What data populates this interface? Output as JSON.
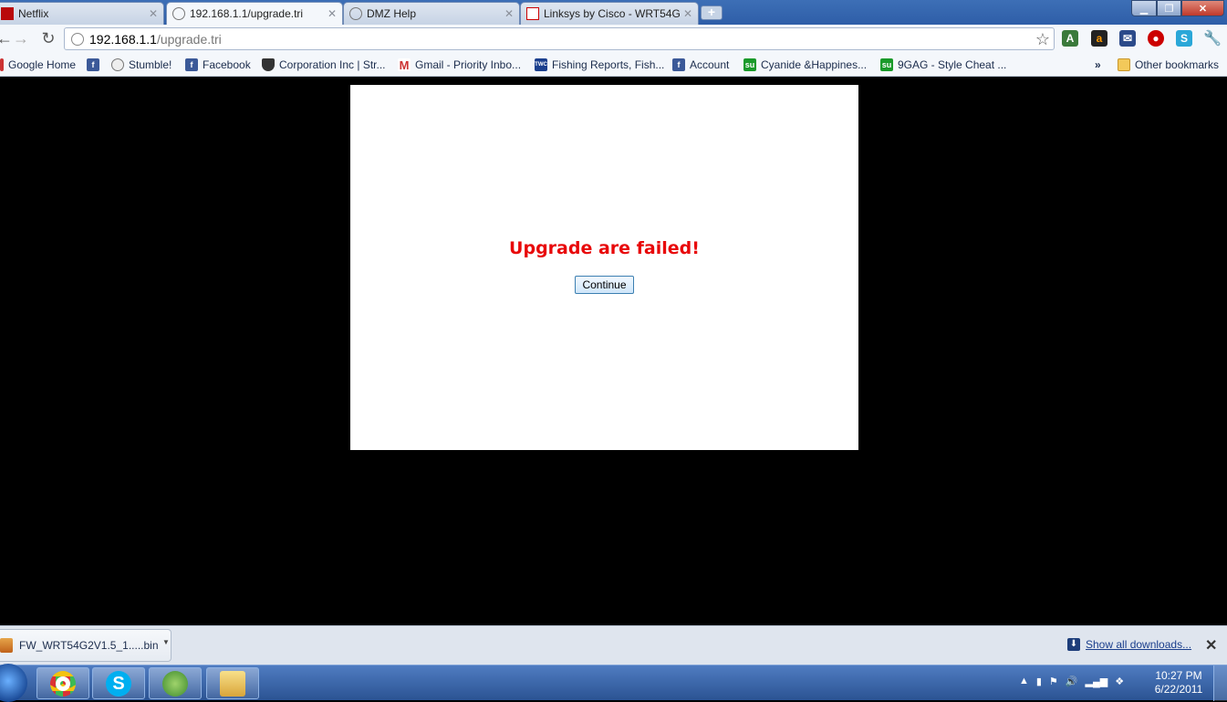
{
  "tabs": [
    {
      "title": "Netflix",
      "active": false
    },
    {
      "title": "192.168.1.1/upgrade.tri",
      "active": true
    },
    {
      "title": "DMZ Help",
      "active": false
    },
    {
      "title": "Linksys by Cisco - WRT54G",
      "active": false
    }
  ],
  "omnibox": {
    "host": "192.168.1.1",
    "path": "/upgrade.tri"
  },
  "bookmarks": [
    {
      "label": "Google Home",
      "icon": "google-icon"
    },
    {
      "label": "Stumble!",
      "icon": "globe-icon"
    },
    {
      "label": "Facebook",
      "icon": "facebook-icon"
    },
    {
      "label": "Corporation Inc | Str...",
      "icon": "shield-icon"
    },
    {
      "label": "Gmail - Priority Inbo...",
      "icon": "gmail-icon"
    },
    {
      "label": "Fishing Reports, Fish...",
      "icon": "twc-icon"
    },
    {
      "label": "Account",
      "icon": "facebook-icon"
    },
    {
      "label": "Cyanide &Happines...",
      "icon": "stumbleupon-icon"
    },
    {
      "label": "9GAG - Style Cheat ...",
      "icon": "stumbleupon-icon"
    }
  ],
  "other_bookmarks": "Other bookmarks",
  "page": {
    "message": "Upgrade are failed!",
    "continue_label": "Continue"
  },
  "downloads": {
    "file": "FW_WRT54G2V1.5_1.....bin",
    "show_all": "Show all downloads..."
  },
  "clock": {
    "time": "10:27 PM",
    "date": "6/22/2011"
  },
  "colors": {
    "error": "#e8080a",
    "accent": "#2e5ea8"
  }
}
